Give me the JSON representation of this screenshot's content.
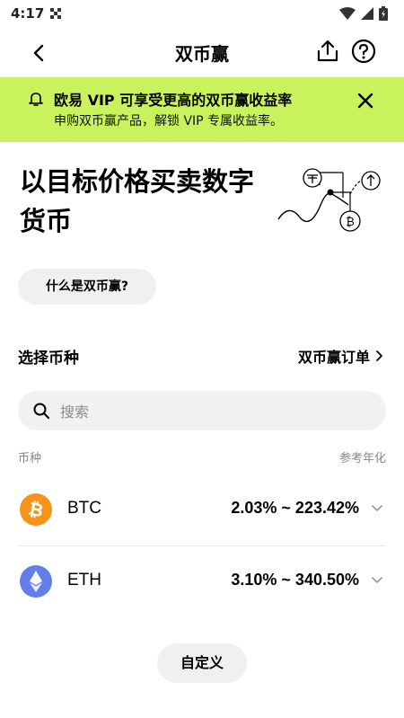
{
  "status_bar": {
    "time": "4:17"
  },
  "nav": {
    "title": "双币赢"
  },
  "banner": {
    "title": "欧易 VIP 可享受更高的双币赢收益率",
    "subtitle": "申购双币赢产品，解锁 VIP 专属收益率。"
  },
  "hero": {
    "title": "以目标价格买卖数字货币",
    "what_button": "什么是双币赢?"
  },
  "section": {
    "title": "选择币种",
    "orders_link": "双币赢订单"
  },
  "search": {
    "placeholder": "搜索"
  },
  "columns": {
    "coin": "币种",
    "apy": "参考年化"
  },
  "coins": [
    {
      "symbol": "BTC",
      "rate": "2.03% ~ 223.42%",
      "color": "#f7931a"
    },
    {
      "symbol": "ETH",
      "rate": "3.10% ~ 340.50%",
      "color": "#627eea"
    }
  ],
  "footer": {
    "custom_button": "自定义"
  }
}
